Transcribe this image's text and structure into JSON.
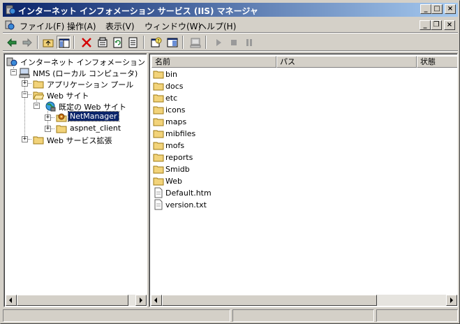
{
  "window": {
    "title": "インターネット インフォメーション サービス (IIS) マネージャ",
    "minimize_glyph": "_",
    "maximize_glyph": "□",
    "close_glyph": "×"
  },
  "menu": {
    "items": [
      {
        "label": "ファイル(F)"
      },
      {
        "label": "操作(A)"
      },
      {
        "label": "表示(V)"
      },
      {
        "label": "ウィンドウ(W)"
      },
      {
        "label": "ヘルプ(H)"
      }
    ],
    "mdi_minimize_glyph": "_",
    "mdi_restore_glyph": "❐",
    "mdi_close_glyph": "×"
  },
  "toolbar": {
    "buttons": [
      "back-icon",
      "forward-icon",
      "up-folder-icon",
      "show-tree-icon",
      "delete-icon",
      "properties-icon",
      "refresh-icon",
      "export-list-icon",
      "help-icon",
      "console-icon",
      "computer-icon",
      "start-icon",
      "stop-icon",
      "pause-icon"
    ]
  },
  "tree": {
    "root": "インターネット インフォメーション サービス",
    "server": "NMS (ローカル コンピュータ)",
    "app_pools": "アプリケーション プール",
    "web_sites": "Web サイト",
    "default_site": "既定の Web サイト",
    "netmanager": "NetManager",
    "aspnet_client": "aspnet_client",
    "web_ext": "Web サービス拡張"
  },
  "list": {
    "columns": [
      "名前",
      "パス",
      "状態"
    ],
    "rows": [
      {
        "name": "bin",
        "type": "folder"
      },
      {
        "name": "docs",
        "type": "folder"
      },
      {
        "name": "etc",
        "type": "folder"
      },
      {
        "name": "icons",
        "type": "folder"
      },
      {
        "name": "maps",
        "type": "folder"
      },
      {
        "name": "mibfiles",
        "type": "folder"
      },
      {
        "name": "mofs",
        "type": "folder"
      },
      {
        "name": "reports",
        "type": "folder"
      },
      {
        "name": "Smidb",
        "type": "folder"
      },
      {
        "name": "Web",
        "type": "folder"
      },
      {
        "name": "Default.htm",
        "type": "file"
      },
      {
        "name": "version.txt",
        "type": "file"
      }
    ]
  },
  "colors": {
    "titlebar_start": "#0a246a",
    "titlebar_end": "#a6caf0",
    "face": "#d4d0c8",
    "selection": "#0a246a"
  }
}
